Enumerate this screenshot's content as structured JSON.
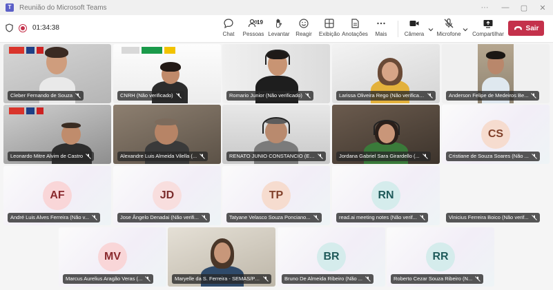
{
  "window": {
    "title": "Reunião do Microsoft Teams"
  },
  "meeting": {
    "timer": "01:34:38"
  },
  "toolbar": {
    "chat": "Chat",
    "people": "Pessoas",
    "people_count": "19",
    "raise": "Levantar",
    "react": "Reagir",
    "view": "Exibição",
    "notes": "Anotações",
    "more": "Mais",
    "camera": "Câmera",
    "mic": "Microfone",
    "share": "Compartilhar",
    "leave": "Sair"
  },
  "colors": {
    "accent": "#5b5fc7",
    "leave": "#c4314b",
    "record": "#c4314b"
  },
  "participants": [
    {
      "name": "Cleber Fernando de Souza",
      "type": "video"
    },
    {
      "name": "CNRH (Não verificado)",
      "type": "video"
    },
    {
      "name": "Romario Junior (Não verificado)",
      "type": "video"
    },
    {
      "name": "Larissa Oliveira Rego (Não verificado)",
      "type": "video"
    },
    {
      "name": "Anderson Felipe de Medeiros Be...",
      "type": "video"
    },
    {
      "name": "Leonardo Mitre Alvim de Castro",
      "type": "video"
    },
    {
      "name": "Alexandre Luis Almeida Vilella (...",
      "type": "video"
    },
    {
      "name": "RENATO JUNIO CONSTANCIO (Exter...",
      "type": "video"
    },
    {
      "name": "Jordana Gabriel Sara Girardello (...",
      "type": "video"
    },
    {
      "name": "Cristiane de Souza Soares (Não ...",
      "type": "avatar",
      "initials": "CS"
    },
    {
      "name": "André Luis Alves Ferreira (Não v...",
      "type": "avatar",
      "initials": "AF"
    },
    {
      "name": "Jose Ângelo Denadai (Não verifi...",
      "type": "avatar",
      "initials": "JD"
    },
    {
      "name": "Tatyane Velasco Souza Ponciano...",
      "type": "avatar",
      "initials": "TP"
    },
    {
      "name": "read.ai meeting notes (Não verif...",
      "type": "avatar",
      "initials": "RN"
    },
    {
      "name": "Vinicius Ferreira Boico (Não verif...",
      "type": "avatar",
      "initials": ""
    },
    {
      "name": "Marcus Aurelius Aragão Veras (...",
      "type": "avatar",
      "initials": "MV"
    },
    {
      "name": "Maryelle da S. Ferreira - SEMAS/PA (...",
      "type": "video"
    },
    {
      "name": "Bruno De Almeida Ribeiro (Não ...",
      "type": "avatar",
      "initials": "BR"
    },
    {
      "name": "Roberto Cezar Souza Ribeiro (N...",
      "type": "avatar",
      "initials": "RR"
    }
  ]
}
